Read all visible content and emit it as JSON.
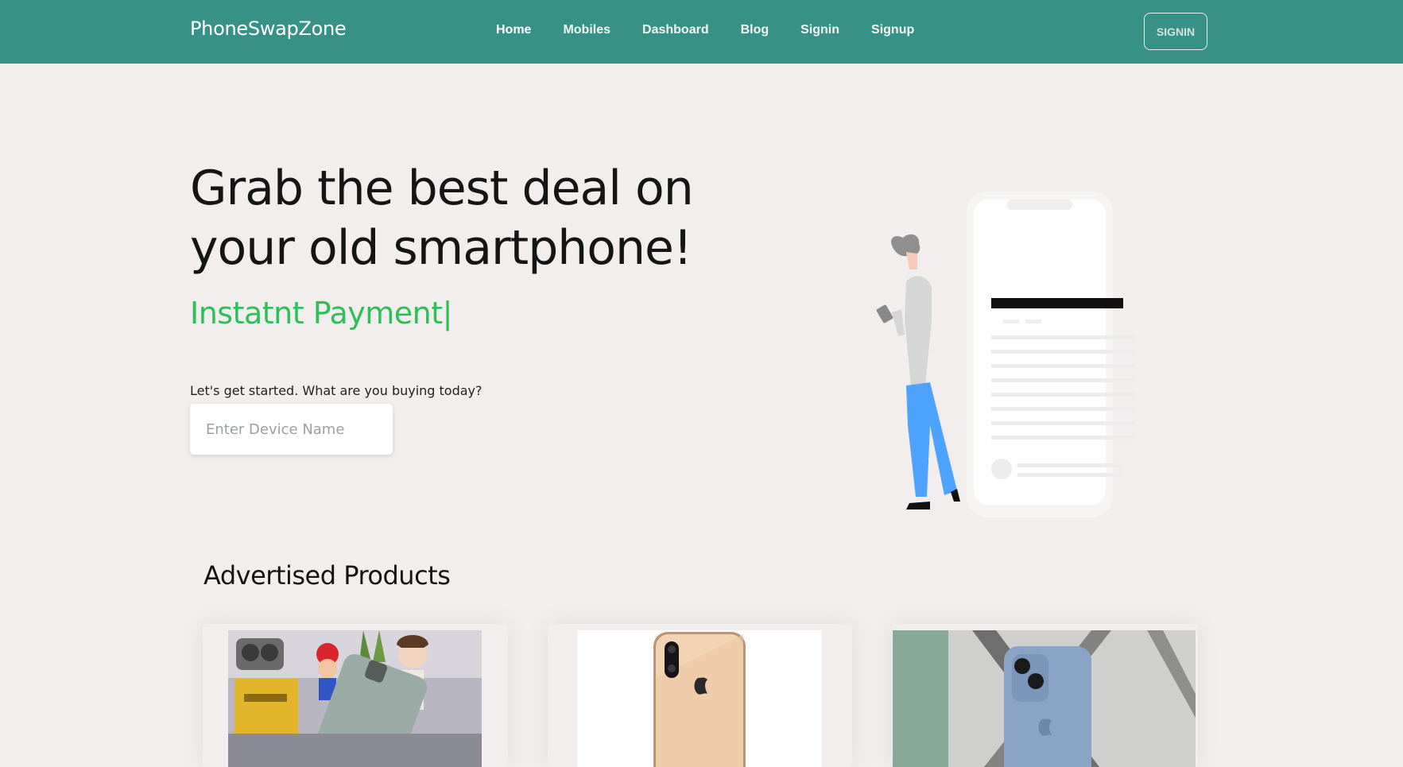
{
  "header": {
    "brand": "PhoneSwapZone",
    "nav": [
      {
        "label": "Home"
      },
      {
        "label": "Mobiles"
      },
      {
        "label": "Dashboard"
      },
      {
        "label": "Blog"
      },
      {
        "label": "Signin"
      },
      {
        "label": "Signup"
      }
    ],
    "signin_button": "SIGNIN"
  },
  "hero": {
    "title": "Grab the best deal on your old smartphone!",
    "typed_text": "Instatnt Payment",
    "cursor": "|",
    "prompt": "Let's get started. What are you buying today?",
    "search": {
      "placeholder": "Enter Device Name",
      "value": ""
    }
  },
  "products_section": {
    "title": "Advertised Products",
    "products": [
      {
        "image": "pixel-phone-with-toys-photo"
      },
      {
        "image": "gold-iphone-back-photo"
      },
      {
        "image": "blue-iphone-back-photo"
      }
    ]
  },
  "colors": {
    "header_bg": "#379187",
    "page_bg": "#f1eeed",
    "accent_green": "#2fbf59",
    "illustration_blue": "#4da3ff"
  }
}
